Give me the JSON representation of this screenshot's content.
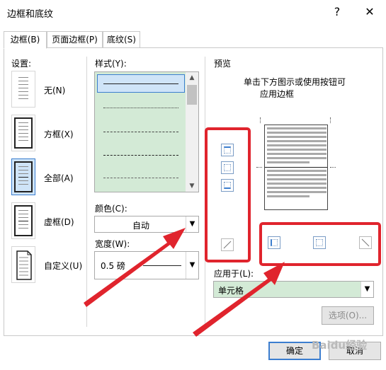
{
  "window": {
    "title": "边框和底纹",
    "help_label": "?",
    "close_label": "✕"
  },
  "tabs": [
    {
      "label": "边框(B)",
      "active": true
    },
    {
      "label": "页面边框(P)",
      "active": false
    },
    {
      "label": "底纹(S)",
      "active": false
    }
  ],
  "settings": {
    "label": "设置:",
    "items": [
      {
        "label": "无(N)",
        "icon": "no-border-icon"
      },
      {
        "label": "方框(X)",
        "icon": "box-border-icon"
      },
      {
        "label": "全部(A)",
        "icon": "all-borders-icon",
        "selected": true
      },
      {
        "label": "虚框(D)",
        "icon": "grid-border-icon"
      },
      {
        "label": "自定义(U)",
        "icon": "custom-border-icon"
      }
    ]
  },
  "style": {
    "label": "样式(Y):",
    "line_styles": [
      "solid",
      "dotted",
      "dashed-small",
      "dashed",
      "dash-dot"
    ]
  },
  "color": {
    "label": "颜色(C):",
    "value": "自动"
  },
  "width": {
    "label": "宽度(W):",
    "value": "0.5 磅"
  },
  "preview": {
    "label": "预览",
    "hint_line1": "单击下方图示或使用按钮可",
    "hint_line2": "应用边框"
  },
  "apply_to": {
    "label": "应用于(L):",
    "value": "单元格"
  },
  "buttons": {
    "options": "选项(O)...",
    "ok": "确定",
    "cancel": "取消"
  },
  "watermark": "Baidu经验",
  "colors": {
    "accent": "#3c7ecf",
    "list_background": "#d3ead6",
    "annotation_red": "#e0242d"
  }
}
